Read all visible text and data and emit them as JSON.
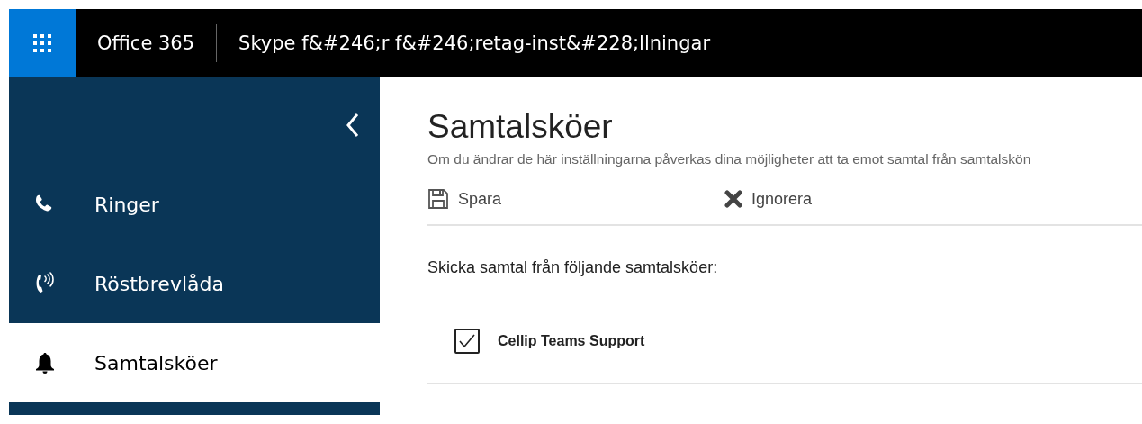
{
  "header": {
    "app_name": "Office 365",
    "title": "Skype f&#246;r f&#246;retag-inst&#228;llningar"
  },
  "sidebar": {
    "items": [
      {
        "label": "Ringer",
        "kind": "phone",
        "selected": false
      },
      {
        "label": "Röstbrevlåda",
        "kind": "voicemail",
        "selected": false
      },
      {
        "label": "Samtalsköer",
        "kind": "bell",
        "selected": true
      }
    ]
  },
  "main": {
    "title": "Samtalsköer",
    "subtitle": "Om du ändrar de här inställningarna påverkas dina möjligheter att ta emot samtal från samtalskön",
    "toolbar": [
      {
        "label": "Spara",
        "kind": "save"
      },
      {
        "label": "Ignorera",
        "kind": "discard"
      }
    ],
    "prompt": "Skicka samtal från följande samtalsköer:",
    "queues": [
      {
        "label": "Cellip Teams Support",
        "checked": true
      }
    ]
  }
}
